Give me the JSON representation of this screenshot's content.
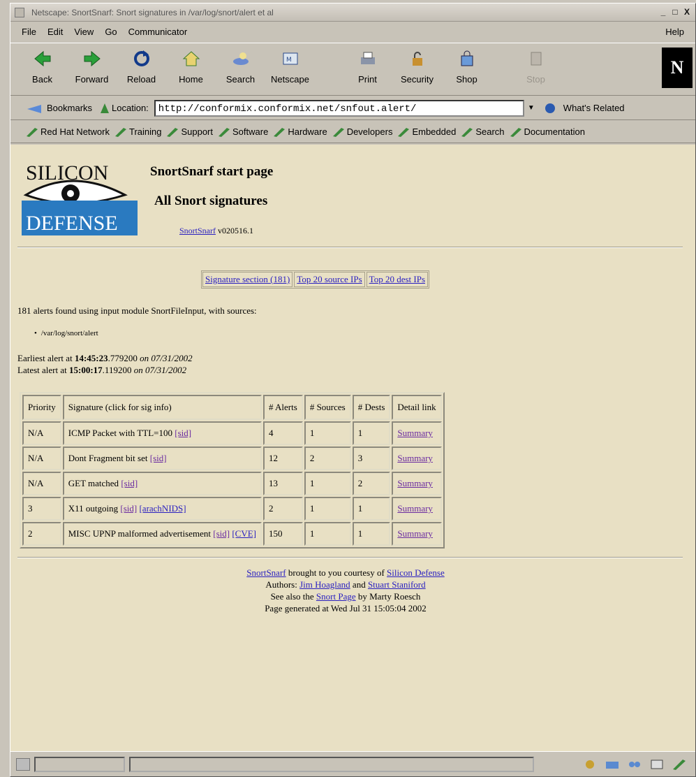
{
  "window": {
    "title": "Netscape: SnortSnarf: Snort signatures in /var/log/snort/alert et al"
  },
  "menu": [
    "File",
    "Edit",
    "View",
    "Go",
    "Communicator",
    "Help"
  ],
  "toolbar": {
    "back": "Back",
    "forward": "Forward",
    "reload": "Reload",
    "home": "Home",
    "search": "Search",
    "netscape": "Netscape",
    "print": "Print",
    "security": "Security",
    "shop": "Shop",
    "stop": "Stop",
    "logo": "N"
  },
  "location": {
    "bookmarks": "Bookmarks",
    "label": "Location:",
    "url": "http://conformix.conformix.net/snfout.alert/",
    "related": "What's Related"
  },
  "personal": [
    "Red Hat Network",
    "Training",
    "Support",
    "Software",
    "Hardware",
    "Developers",
    "Embedded",
    "Search",
    "Documentation"
  ],
  "page": {
    "logo_top": "SILICON",
    "logo_bottom": "DEFENSE",
    "heading1": "SnortSnarf start page",
    "heading2": "All Snort signatures",
    "version_link": "SnortSnarf",
    "version": "v020516.1",
    "nav": [
      "Signature section (181)",
      "Top 20 source IPs",
      "Top 20 dest IPs"
    ],
    "summary": "181 alerts found using input module SnortFileInput, with sources:",
    "source": "/var/log/snort/alert",
    "earliest_label": "Earliest alert at",
    "earliest_time": "14:45:23",
    "earliest_frac": ".779200",
    "earliest_on": "on",
    "earliest_date": "07/31/2002",
    "latest_label": "Latest alert at",
    "latest_time": "15:00:17",
    "latest_frac": ".119200",
    "latest_on": "on",
    "latest_date": "07/31/2002"
  },
  "table": {
    "headers": [
      "Priority",
      "Signature (click for sig info)",
      "# Alerts",
      "# Sources",
      "# Dests",
      "Detail link"
    ],
    "rows": [
      {
        "priority": "N/A",
        "sig": "ICMP Packet with TTL=100",
        "links": [
          "[sid]"
        ],
        "alerts": "4",
        "sources": "1",
        "dests": "1",
        "detail": "Summary"
      },
      {
        "priority": "N/A",
        "sig": "Dont Fragment bit set",
        "links": [
          "[sid]"
        ],
        "alerts": "12",
        "sources": "2",
        "dests": "3",
        "detail": "Summary"
      },
      {
        "priority": "N/A",
        "sig": "GET matched",
        "links": [
          "[sid]"
        ],
        "alerts": "13",
        "sources": "1",
        "dests": "2",
        "detail": "Summary"
      },
      {
        "priority": "3",
        "sig": "X11 outgoing",
        "links": [
          "[sid]",
          "[arachNIDS]"
        ],
        "alerts": "2",
        "sources": "1",
        "dests": "1",
        "detail": "Summary"
      },
      {
        "priority": "2",
        "sig": "MISC UPNP malformed advertisement",
        "links": [
          "[sid]",
          "[CVE]"
        ],
        "alerts": "150",
        "sources": "1",
        "dests": "1",
        "detail": "Summary"
      }
    ]
  },
  "footer": {
    "l1_link": "SnortSnarf",
    "l1_text": "brought to you courtesy of",
    "l1_link2": "Silicon Defense",
    "l2_text": "Authors:",
    "l2_link1": "Jim Hoagland",
    "l2_and": "and",
    "l2_link2": "Stuart Staniford",
    "l3_text": "See also the",
    "l3_link": "Snort Page",
    "l3_text2": "by Marty Roesch",
    "l4_text": "Page generated at Wed Jul 31 15:05:04 2002"
  }
}
